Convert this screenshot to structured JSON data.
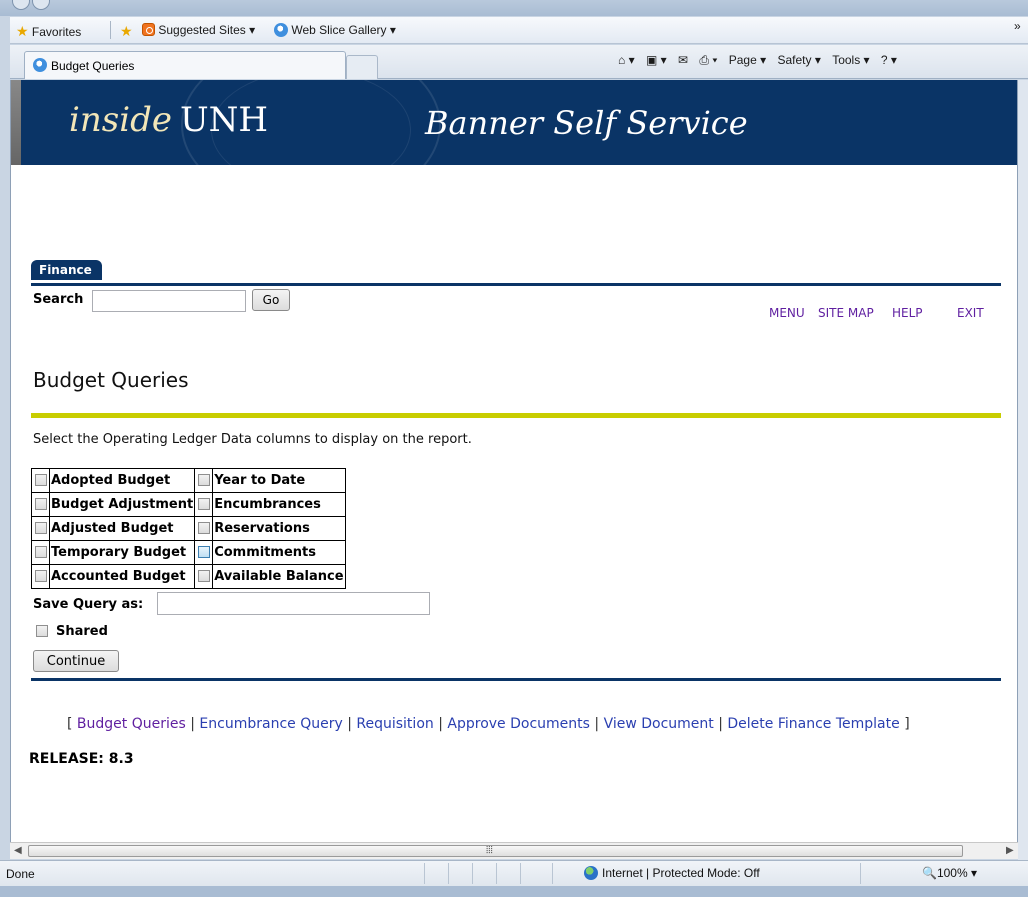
{
  "favorites_bar": {
    "favorites_label": "Favorites",
    "suggested_sites": "Suggested Sites ▾",
    "web_slice_gallery": "Web Slice Gallery ▾",
    "overflow": "»"
  },
  "browser_tab": {
    "title": "Budget Queries"
  },
  "command_bar": {
    "home": "⌂ ▾",
    "feeds": "▣ ▾",
    "mail": "✉",
    "print": "⎙ ▾",
    "page": "Page ▾",
    "safety": "Safety ▾",
    "tools": "Tools ▾",
    "help": "? ▾"
  },
  "header": {
    "brand_inside": "inside",
    "brand_unh": "UNH",
    "title": "Banner Self Service"
  },
  "nav_tab": {
    "label": "Finance"
  },
  "search": {
    "label": "Search",
    "value": "",
    "go_label": "Go"
  },
  "top_links": [
    "MENU",
    "SITE MAP",
    "HELP",
    "EXIT"
  ],
  "page_title": "Budget Queries",
  "instruction": "Select the Operating Ledger Data columns to display on the report.",
  "ledger_columns": {
    "left": [
      "Adopted Budget",
      "Budget Adjustment",
      "Adjusted Budget",
      "Temporary Budget",
      "Accounted Budget"
    ],
    "right": [
      "Year to Date",
      "Encumbrances",
      "Reservations",
      "Commitments",
      "Available Balance"
    ]
  },
  "save_query": {
    "label": "Save Query as:",
    "value": ""
  },
  "shared_label": "Shared",
  "continue_label": "Continue",
  "footer_links": {
    "open_bracket": "[",
    "close_bracket": "]",
    "separator": "|",
    "items": [
      "Budget Queries",
      "Encumbrance Query",
      "Requisition",
      "Approve Documents",
      "View Document",
      "Delete Finance Template"
    ]
  },
  "release": "RELEASE: 8.3",
  "status_bar": {
    "status": "Done",
    "zone": "Internet | Protected Mode: Off",
    "zoom": "100%"
  },
  "colors": {
    "header_navy": "#0a3466",
    "divider_yellow": "#c8cd00",
    "visited_link": "#5f1fa0",
    "link": "#2a3fb0"
  }
}
